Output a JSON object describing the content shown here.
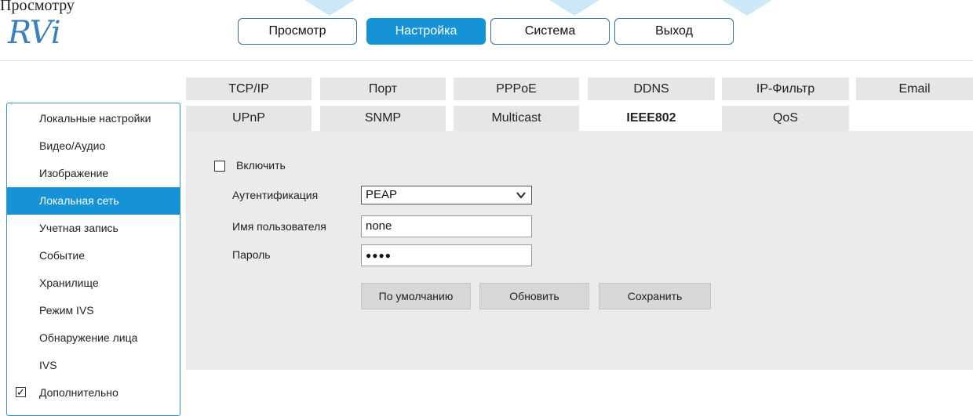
{
  "top_text": "Просмотру",
  "logo": "RVi",
  "header": {
    "buttons": [
      {
        "label": "Просмотр",
        "active": false
      },
      {
        "label": "Настройка",
        "active": true
      },
      {
        "label": "Система",
        "active": false
      },
      {
        "label": "Выход",
        "active": false
      }
    ]
  },
  "sidebar": {
    "items": [
      {
        "label": "Локальные настройки"
      },
      {
        "label": "Видео/Аудио"
      },
      {
        "label": "Изображение"
      },
      {
        "label": "Локальная сеть",
        "active": true
      },
      {
        "label": "Учетная запись"
      },
      {
        "label": "Событие"
      },
      {
        "label": "Хранилище"
      },
      {
        "label": "Режим IVS"
      },
      {
        "label": "Обнаружение лица"
      },
      {
        "label": "IVS"
      },
      {
        "label": "Дополнительно",
        "checked": true
      }
    ]
  },
  "tabs": {
    "row1": [
      "TCP/IP",
      "Порт",
      "PPPoE",
      "DDNS",
      "IP-Фильтр",
      "Email"
    ],
    "row2": [
      "UPnP",
      "SNMP",
      "Multicast",
      "IEEE802",
      "QoS"
    ],
    "active": "IEEE802"
  },
  "form": {
    "enable_label": "Включить",
    "auth_label": "Аутентификация",
    "auth_value": "PEAP",
    "username_label": "Имя пользователя",
    "username_value": "none",
    "password_label": "Пароль",
    "password_value": "●●●●"
  },
  "actions": {
    "default_label": "По умолчанию",
    "refresh_label": "Обновить",
    "save_label": "Сохранить"
  },
  "colors": {
    "accent": "#1593d6",
    "panel": "#ebebeb",
    "tab": "#e6e6e6"
  }
}
